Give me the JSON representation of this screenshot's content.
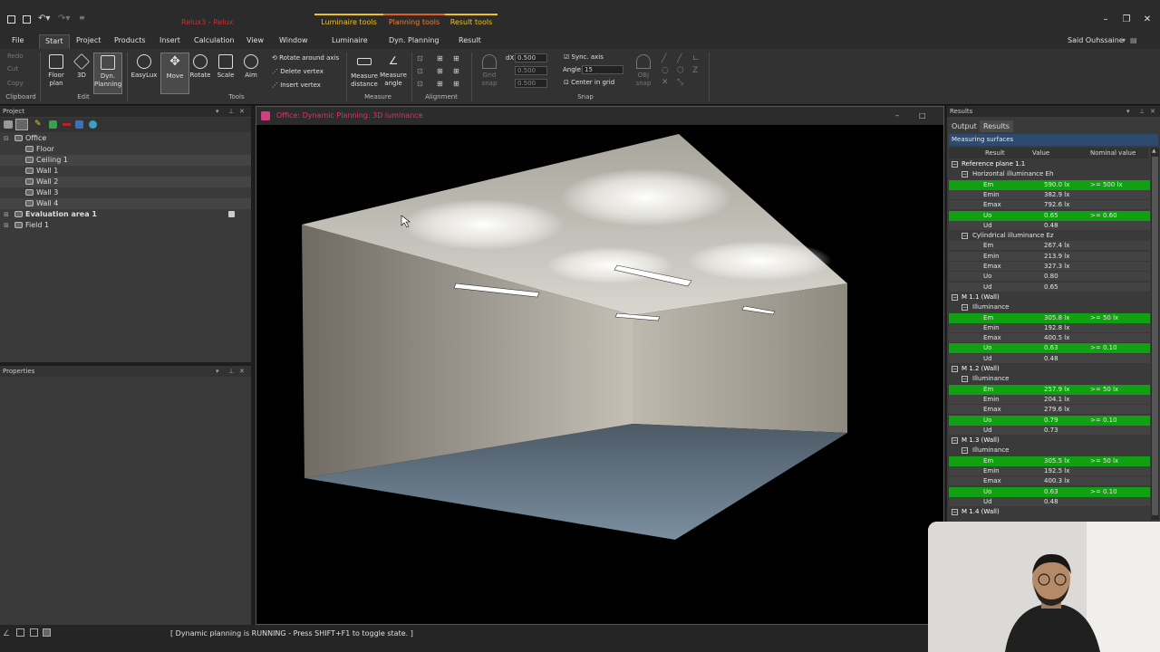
{
  "titlebar": {
    "doc_title": "Relux3 - Relux",
    "ctx_tabs": [
      "Luminaire tools",
      "Planning tools",
      "Result tools"
    ]
  },
  "menu": {
    "items": [
      "File",
      "Start",
      "Project",
      "Products",
      "Insert",
      "Calculation",
      "View",
      "Window",
      "Luminaire",
      "Dyn. Planning",
      "Result"
    ],
    "user": "Said Ouhssaine"
  },
  "ribbon": {
    "clipboard": {
      "items": [
        "Redo",
        "Cut",
        "Copy"
      ],
      "label": "Clipboard"
    },
    "edit": {
      "floor": "Floor\nplan",
      "threed": "3D",
      "dyn": "Dyn.\nPlanning",
      "label": "Edit"
    },
    "tools": {
      "easylux": "EasyLux",
      "move": "Move",
      "rotate": "Rotate",
      "scale": "Scale",
      "aim": "Aim",
      "rotate_axis": "Rotate around axis",
      "delete_vertex": "Delete vertex",
      "insert_vertex": "Insert vertex",
      "label": "Tools"
    },
    "measure": {
      "distance": "Measure\ndistance",
      "angle": "Measure\nangle",
      "label": "Measure"
    },
    "alignment": {
      "label": "Alignment"
    },
    "snap": {
      "dx_label": "dX",
      "dx": "0.500",
      "dy": "0.500",
      "dz": "0.500",
      "sync": "Sync. axis",
      "angle_label": "Angle",
      "angle": "15",
      "center": "Center in grid",
      "grid_snap": "Grid\nsnap",
      "obj_snap": "OBJ\nsnap",
      "label": "Snap"
    }
  },
  "project_panel": {
    "title": "Project",
    "tree": [
      {
        "label": "Office",
        "level": 1
      },
      {
        "label": "Floor",
        "level": 2
      },
      {
        "label": "Ceiling 1",
        "level": 2
      },
      {
        "label": "Wall 1",
        "level": 2
      },
      {
        "label": "Wall 2",
        "level": 2
      },
      {
        "label": "Wall 3",
        "level": 2
      },
      {
        "label": "Wall 4",
        "level": 2
      },
      {
        "label": "Evaluation area 1",
        "level": 1
      },
      {
        "label": "Field 1",
        "level": 1
      }
    ]
  },
  "properties_panel": {
    "title": "Properties"
  },
  "viewport": {
    "title": "Office: Dynamic Planning: 3D luminance"
  },
  "results_panel": {
    "title": "Results",
    "tabs": [
      "Output",
      "Results"
    ],
    "section": "Measuring surfaces",
    "columns": [
      "Result",
      "Value",
      "Nominal value"
    ],
    "rows": [
      {
        "name": "Reference plane 1.1",
        "value": "",
        "nominal": "",
        "kind": "hdr"
      },
      {
        "name": "Horizontal illuminance Eh",
        "value": "",
        "nominal": "",
        "kind": "sub"
      },
      {
        "name": "Em",
        "value": "590.0 lx",
        "nominal": ">= 500 lx",
        "kind": "pass"
      },
      {
        "name": "Emin",
        "value": "382.9 lx",
        "nominal": "",
        "kind": "plain"
      },
      {
        "name": "Emax",
        "value": "792.6 lx",
        "nominal": "",
        "kind": "plain"
      },
      {
        "name": "Uo",
        "value": "0.65",
        "nominal": ">= 0.60",
        "kind": "pass"
      },
      {
        "name": "Ud",
        "value": "0.48",
        "nominal": "",
        "kind": "plain"
      },
      {
        "name": "Cylindrical illuminance Ez",
        "value": "",
        "nominal": "",
        "kind": "sub"
      },
      {
        "name": "Em",
        "value": "267.4 lx",
        "nominal": "",
        "kind": "plain"
      },
      {
        "name": "Emin",
        "value": "213.9 lx",
        "nominal": "",
        "kind": "plain"
      },
      {
        "name": "Emax",
        "value": "327.3 lx",
        "nominal": "",
        "kind": "plain"
      },
      {
        "name": "Uo",
        "value": "0.80",
        "nominal": "",
        "kind": "plain"
      },
      {
        "name": "Ud",
        "value": "0.65",
        "nominal": "",
        "kind": "plain"
      },
      {
        "name": "M 1.1 (Wall)",
        "value": "",
        "nominal": "",
        "kind": "hdr"
      },
      {
        "name": "Illuminance",
        "value": "",
        "nominal": "",
        "kind": "sub"
      },
      {
        "name": "Em",
        "value": "305.8 lx",
        "nominal": ">= 50 lx",
        "kind": "pass"
      },
      {
        "name": "Emin",
        "value": "192.8 lx",
        "nominal": "",
        "kind": "plain"
      },
      {
        "name": "Emax",
        "value": "400.5 lx",
        "nominal": "",
        "kind": "plain"
      },
      {
        "name": "Uo",
        "value": "0.63",
        "nominal": ">= 0.10",
        "kind": "pass"
      },
      {
        "name": "Ud",
        "value": "0.48",
        "nominal": "",
        "kind": "plain"
      },
      {
        "name": "M 1.2 (Wall)",
        "value": "",
        "nominal": "",
        "kind": "hdr"
      },
      {
        "name": "Illuminance",
        "value": "",
        "nominal": "",
        "kind": "sub"
      },
      {
        "name": "Em",
        "value": "257.9 lx",
        "nominal": ">= 50 lx",
        "kind": "pass"
      },
      {
        "name": "Emin",
        "value": "204.1 lx",
        "nominal": "",
        "kind": "plain"
      },
      {
        "name": "Emax",
        "value": "279.6 lx",
        "nominal": "",
        "kind": "plain"
      },
      {
        "name": "Uo",
        "value": "0.79",
        "nominal": ">= 0.10",
        "kind": "pass"
      },
      {
        "name": "Ud",
        "value": "0.73",
        "nominal": "",
        "kind": "plain"
      },
      {
        "name": "M 1.3 (Wall)",
        "value": "",
        "nominal": "",
        "kind": "hdr"
      },
      {
        "name": "Illuminance",
        "value": "",
        "nominal": "",
        "kind": "sub"
      },
      {
        "name": "Em",
        "value": "305.5 lx",
        "nominal": ">= 50 lx",
        "kind": "pass"
      },
      {
        "name": "Emin",
        "value": "192.5 lx",
        "nominal": "",
        "kind": "plain"
      },
      {
        "name": "Emax",
        "value": "400.3 lx",
        "nominal": "",
        "kind": "plain"
      },
      {
        "name": "Uo",
        "value": "0.63",
        "nominal": ">= 0.10",
        "kind": "pass"
      },
      {
        "name": "Ud",
        "value": "0.48",
        "nominal": "",
        "kind": "plain"
      },
      {
        "name": "M 1.4 (Wall)",
        "value": "",
        "nominal": "",
        "kind": "hdr"
      }
    ]
  },
  "status": {
    "text": "[ Dynamic planning is RUNNING - Press SHIFT+F1 to toggle state. ]"
  },
  "colors": {
    "pass": "#11a011",
    "ctx_accent": "#f0c020",
    "doc_title": "#e0307a",
    "ctx_tab_text": "#f08030"
  }
}
